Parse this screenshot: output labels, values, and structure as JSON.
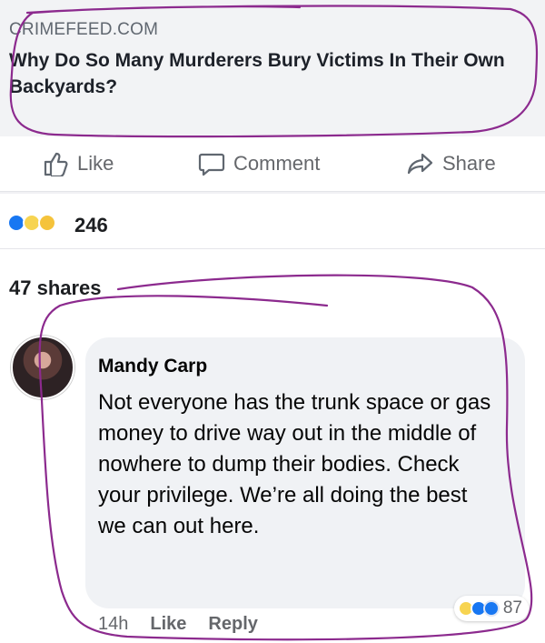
{
  "link_preview": {
    "source": "CRIMEFEED.COM",
    "headline": "Why Do So Many Murderers Bury Victims In Their Own Backyards?"
  },
  "actions": {
    "like": "Like",
    "comment": "Comment",
    "share": "Share"
  },
  "reactions": {
    "count": "246",
    "types": [
      "like",
      "haha",
      "wow"
    ]
  },
  "shares": {
    "label": "47 shares"
  },
  "comment": {
    "author": "Mandy Carp",
    "text": "Not everyone has the trunk space or gas money to drive way out in the middle of nowhere to dump their bodies. Check your privilege. We’re all doing the best we can out here.",
    "time": "14h",
    "like_label": "Like",
    "reply_label": "Reply",
    "reaction_count": "87",
    "reaction_types": [
      "haha",
      "like",
      "love"
    ]
  },
  "colors": {
    "annotation_stroke": "#8c2a8e",
    "like_blue": "#1877f2",
    "haha_yellow": "#f7d451",
    "love_red": "#f33e58"
  }
}
